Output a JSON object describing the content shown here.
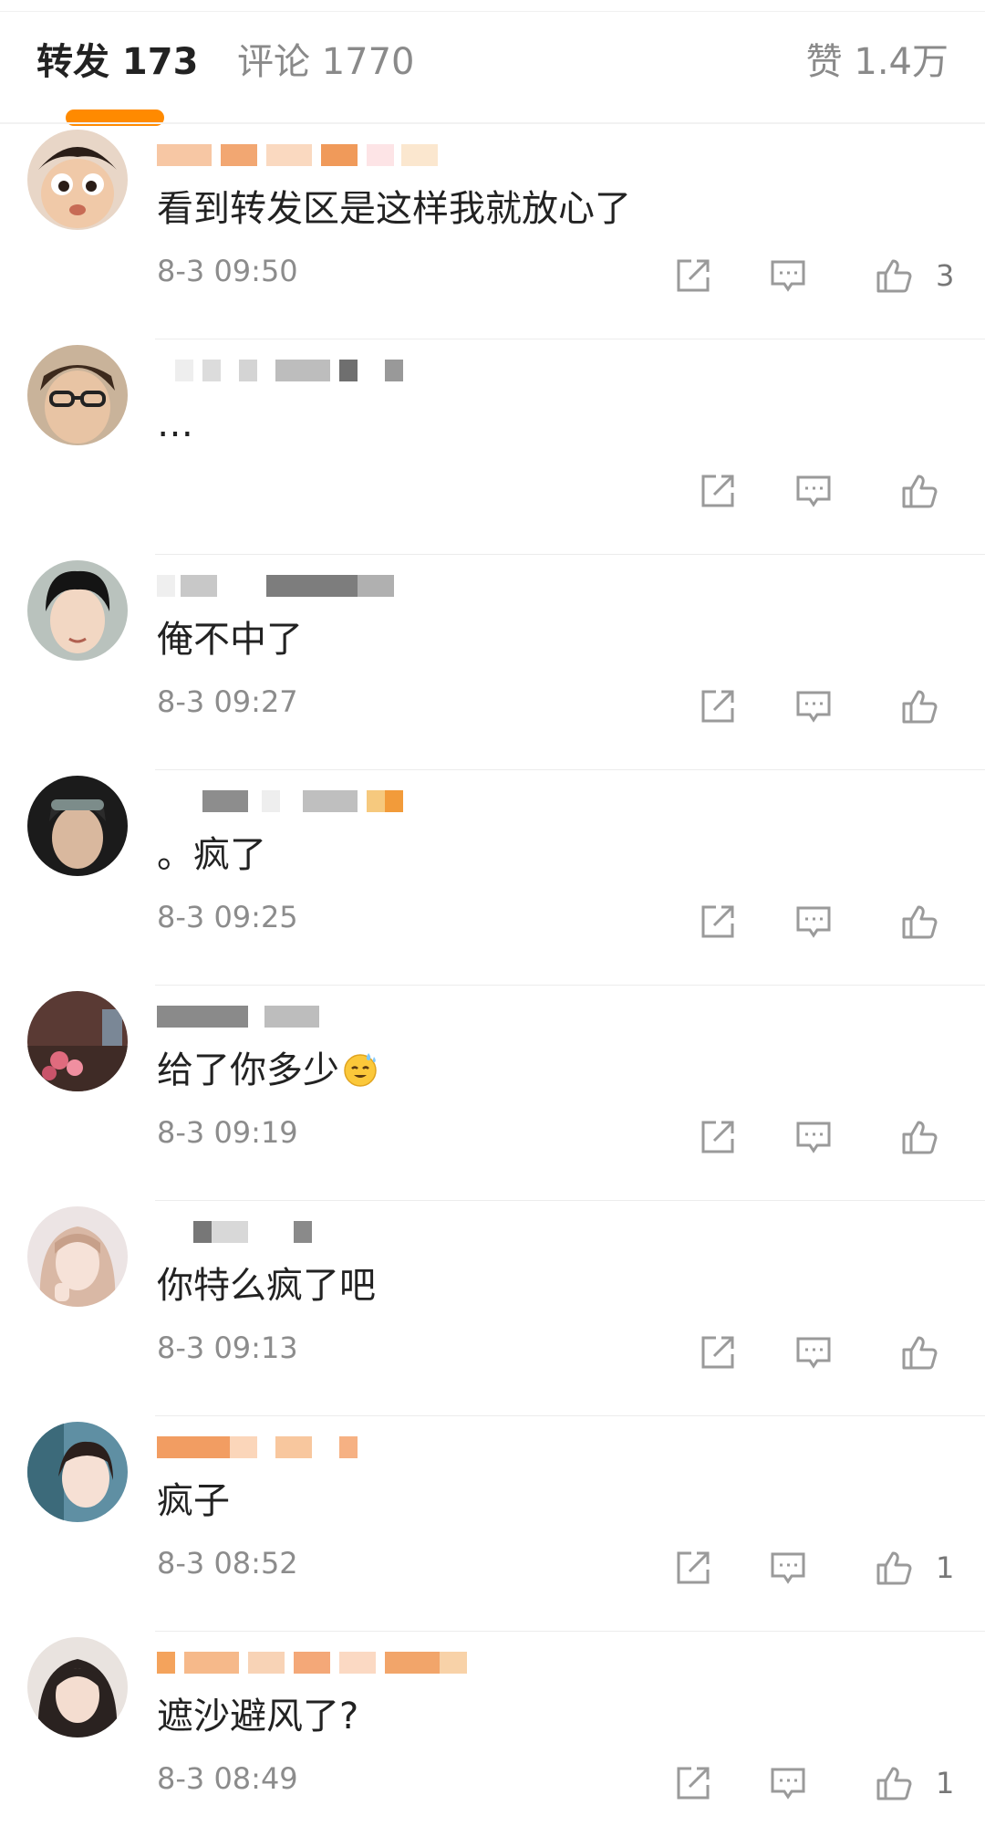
{
  "tabs": [
    {
      "label": "转发 173"
    },
    {
      "label": "评论 1770"
    },
    {
      "label": "赞 1.4万"
    }
  ],
  "colors": {
    "accent": "#ff8a00",
    "muted_text": "#8a8a8a",
    "icon": "#9a9a9a"
  },
  "comments": [
    {
      "text": "看到转发区是这样我就放心了",
      "time": "8-3 09:50",
      "likes": "3"
    },
    {
      "text": "…",
      "time": "",
      "likes": ""
    },
    {
      "text": "俺不中了",
      "time": "8-3 09:27",
      "likes": ""
    },
    {
      "text": "。疯了",
      "time": "8-3 09:25",
      "likes": ""
    },
    {
      "text": "给了你多少",
      "emoji": "sweat-smile-emoji",
      "time": "8-3 09:19",
      "likes": ""
    },
    {
      "text": "你特么疯了吧",
      "time": "8-3 09:13",
      "likes": ""
    },
    {
      "text": "疯子",
      "time": "8-3 08:52",
      "likes": "1"
    },
    {
      "text": "遮沙避风了?",
      "time": "8-3 08:49",
      "likes": "1"
    }
  ],
  "icons": {
    "share": "share-icon",
    "comment": "comment-icon",
    "like": "thumbs-up-icon"
  }
}
